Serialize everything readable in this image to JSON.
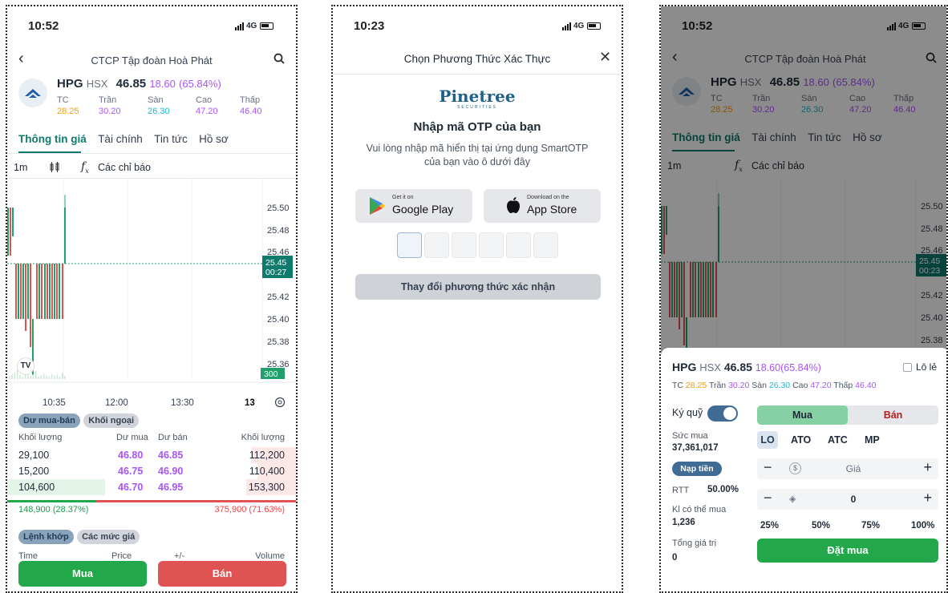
{
  "status_bar": {
    "time_left": "10:52",
    "time_middle": "10:23",
    "time_right": "10:52",
    "network": "4G"
  },
  "stock": {
    "name": "CTCP Tập đoàn Hoà Phát",
    "ticker": "HPG",
    "exchange": "HSX",
    "price": "46.85",
    "change": "18.60",
    "change_pct": "(65.84%)",
    "change_combined": "18.60(65.84%)",
    "labels": {
      "tc": "TC",
      "tran": "Trần",
      "san": "Sàn",
      "cao": "Cao",
      "thap": "Thấp"
    },
    "values": {
      "tc": "28.25",
      "tran": "30.20",
      "san": "26.30",
      "cao": "47.20",
      "thap": "46.40"
    }
  },
  "tabs": [
    "Thông tin giá",
    "Tài chính",
    "Tin tức",
    "Hồ sơ"
  ],
  "chart_toolbar": {
    "interval": "1m",
    "indicators": "Các chỉ báo"
  },
  "chart": {
    "price_ticks": [
      "25.50",
      "25.48",
      "25.46",
      "25.42",
      "25.40",
      "25.38",
      "25.36"
    ],
    "current_price": "25.45",
    "countdown_left": "00:27",
    "countdown_right": "00:23",
    "volume_tag": "300",
    "time_ticks": [
      "10:35",
      "12:00",
      "13:30"
    ],
    "date_label": "13",
    "colors": {
      "up": "#22a06b",
      "down": "#e05353"
    }
  },
  "orderbook": {
    "pill_active": "Dư mua-bán",
    "pill_inactive": "Khối ngoại",
    "headers": [
      "Khối lượng",
      "Dư mua",
      "Dư bán",
      "Khối lượng"
    ],
    "rows": [
      [
        "29,100",
        "46.80",
        "46.85",
        "112,200"
      ],
      [
        "15,200",
        "46.75",
        "46.90",
        "110,400"
      ],
      [
        "104,600",
        "46.70",
        "46.95",
        "153,300"
      ]
    ],
    "buy_total": "148,900 (28.37%)",
    "sell_total": "375,900 (71.63%)"
  },
  "match_tabs": {
    "active": "Lệnh khớp",
    "inactive": "Các mức giá"
  },
  "match_headers": [
    "Time",
    "Price",
    "+/-",
    "Volume"
  ],
  "actions": {
    "buy": "Mua",
    "sell": "Bán"
  },
  "otp": {
    "title": "Chọn Phương Thức Xác Thực",
    "brand": "Pinetree",
    "brand_sub": "SECURITIES",
    "heading": "Nhập mã OTP của bạn",
    "desc1": "Vui lòng nhập mã hiển thị tại ứng dụng SmartOTP",
    "desc2": "của bạn vào ô dưới đây",
    "google_small": "Get it on",
    "google_big": "Google Play",
    "apple_small": "Download on the",
    "apple_big": "App Store",
    "change_method": "Thay đổi phương thức xác nhận"
  },
  "order": {
    "odd_lot": "Lô lẻ",
    "summary_prefix": "TC",
    "margin_label": "Ký quỹ",
    "buy_tab": "Mua",
    "sell_tab": "Bán",
    "buying_power_label": "Sức mua",
    "buying_power": "37,361,017",
    "order_types": [
      "LO",
      "ATO",
      "ATC",
      "MP"
    ],
    "deposit": "Nạp tiền",
    "price_placeholder": "Giá",
    "qty": "0",
    "rtt_label": "RTT",
    "rtt_value": "50.00%",
    "kl_label": "Kl có thể mua",
    "kl_value": "1,236",
    "percents": [
      "25%",
      "50%",
      "75%",
      "100%"
    ],
    "total_label": "Tổng giá trị",
    "total_value": "0",
    "submit": "Đặt mua"
  }
}
